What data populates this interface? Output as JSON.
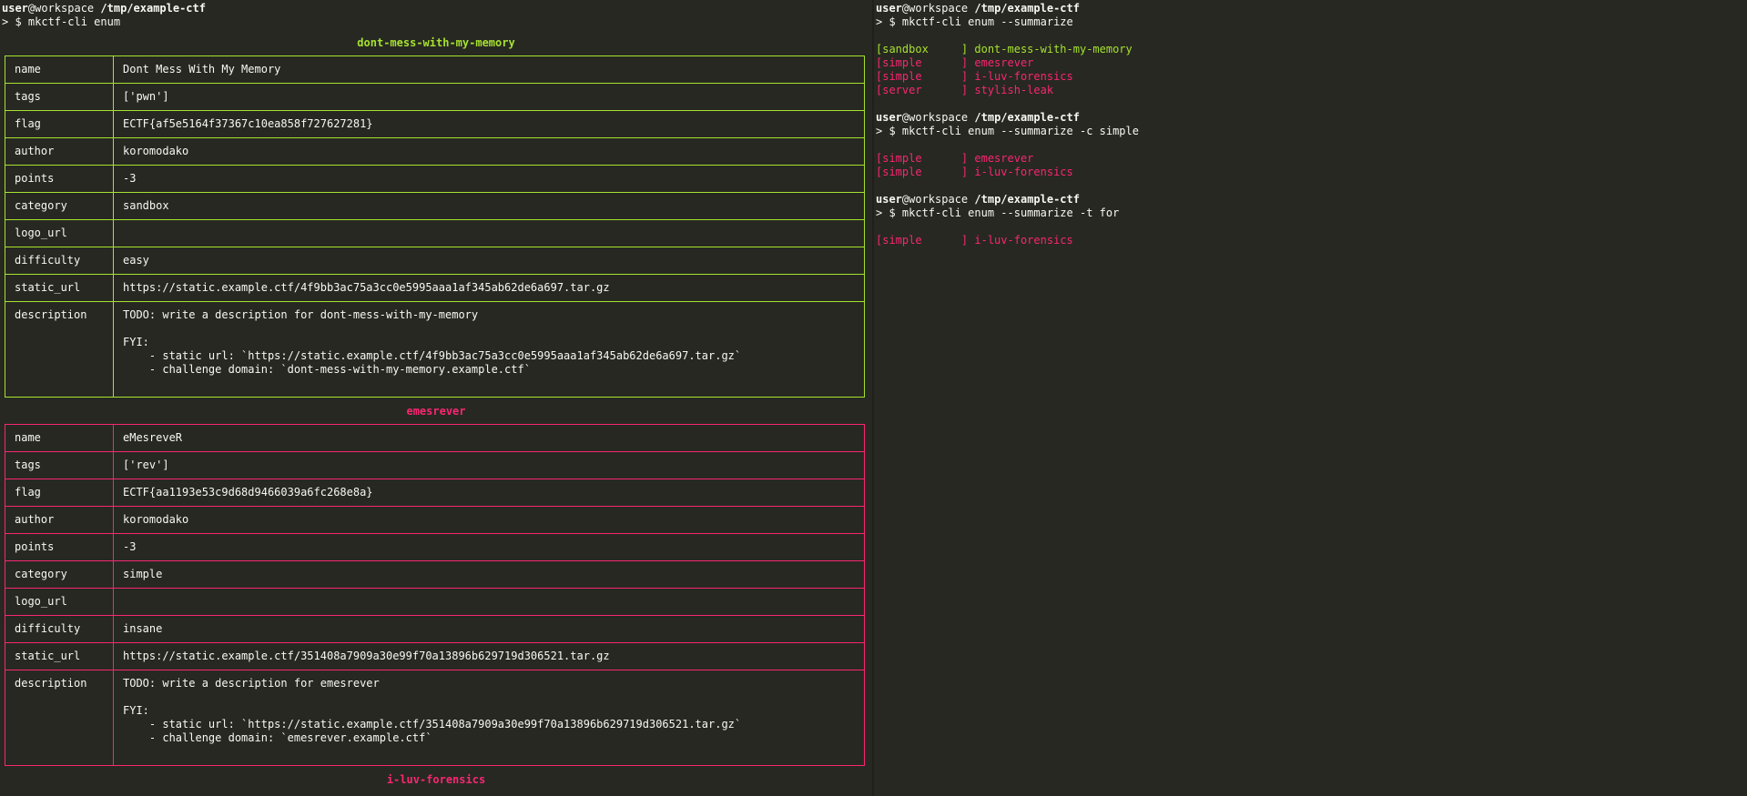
{
  "left": {
    "prompt": {
      "user": "user",
      "host": "@workspace",
      "path": "/tmp/example-ctf",
      "command": "> $ mkctf-cli enum"
    },
    "challenges": [
      {
        "title": "dont-mess-with-my-memory",
        "rows": [
          {
            "key": "name",
            "value": "Dont Mess With My Memory"
          },
          {
            "key": "tags",
            "value": "['pwn']"
          },
          {
            "key": "flag",
            "value": "ECTF{af5e5164f37367c10ea858f727627281}"
          },
          {
            "key": "author",
            "value": "koromodako"
          },
          {
            "key": "points",
            "value": "-3"
          },
          {
            "key": "category",
            "value": "sandbox"
          },
          {
            "key": "logo_url",
            "value": ""
          },
          {
            "key": "difficulty",
            "value": "easy"
          },
          {
            "key": "static_url",
            "value": "https://static.example.ctf/4f9bb3ac75a3cc0e5995aaa1af345ab62de6a697.tar.gz"
          }
        ],
        "description": {
          "key": "description",
          "lines": [
            "TODO: write a description for dont-mess-with-my-memory",
            "",
            "FYI:",
            "    - static url: `https://static.example.ctf/4f9bb3ac75a3cc0e5995aaa1af345ab62de6a697.tar.gz`",
            "    - challenge domain: `dont-mess-with-my-memory.example.ctf`"
          ]
        }
      },
      {
        "title": "emesrever",
        "rows": [
          {
            "key": "name",
            "value": "eMesreveR"
          },
          {
            "key": "tags",
            "value": "['rev']"
          },
          {
            "key": "flag",
            "value": "ECTF{aa1193e53c9d68d9466039a6fc268e8a}"
          },
          {
            "key": "author",
            "value": "koromodako"
          },
          {
            "key": "points",
            "value": "-3"
          },
          {
            "key": "category",
            "value": "simple"
          },
          {
            "key": "logo_url",
            "value": ""
          },
          {
            "key": "difficulty",
            "value": "insane"
          },
          {
            "key": "static_url",
            "value": "https://static.example.ctf/351408a7909a30e99f70a13896b629719d306521.tar.gz"
          }
        ],
        "description": {
          "key": "description",
          "lines": [
            "TODO: write a description for emesrever",
            "",
            "FYI:",
            "    - static url: `https://static.example.ctf/351408a7909a30e99f70a13896b629719d306521.tar.gz`",
            "    - challenge domain: `emesrever.example.ctf`"
          ]
        }
      }
    ],
    "next_title": "i-luv-forensics"
  },
  "right": {
    "blocks": [
      {
        "user": "user",
        "host": "@workspace",
        "path": "/tmp/example-ctf",
        "command": "> $ mkctf-cli enum --summarize",
        "lines": [
          {
            "text": "[sandbox     ] dont-mess-with-my-memory",
            "color": "green"
          },
          {
            "text": "[simple      ] emesrever",
            "color": "pink"
          },
          {
            "text": "[simple      ] i-luv-forensics",
            "color": "pink"
          },
          {
            "text": "[server      ] stylish-leak",
            "color": "pink"
          }
        ]
      },
      {
        "user": "user",
        "host": "@workspace",
        "path": "/tmp/example-ctf",
        "command": "> $ mkctf-cli enum --summarize -c simple",
        "lines": [
          {
            "text": "[simple      ] emesrever",
            "color": "pink"
          },
          {
            "text": "[simple      ] i-luv-forensics",
            "color": "pink"
          }
        ]
      },
      {
        "user": "user",
        "host": "@workspace",
        "path": "/tmp/example-ctf",
        "command": "> $ mkctf-cli enum --summarize -t for",
        "lines": [
          {
            "text": "[simple      ] i-luv-forensics",
            "color": "pink"
          }
        ]
      }
    ]
  },
  "colors": {
    "background": "#272822",
    "foreground": "#f8f8f2",
    "green": "#a6e22e",
    "pink": "#f92672"
  }
}
